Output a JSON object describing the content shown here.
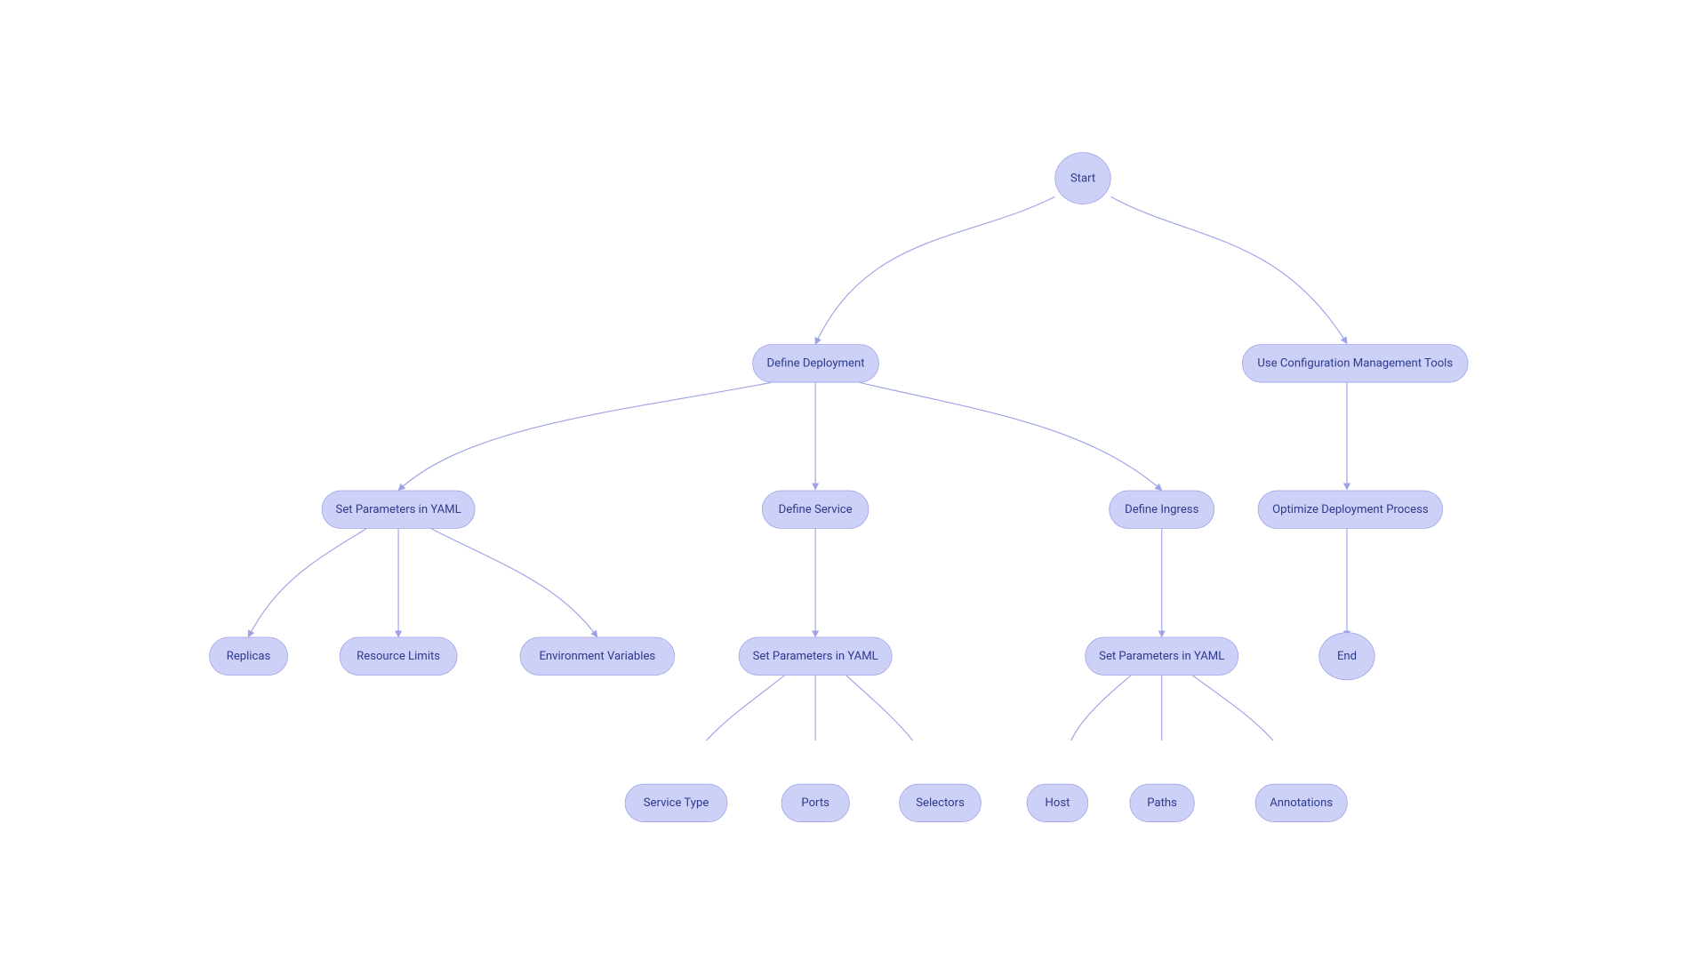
{
  "colors": {
    "nodeFill": "#cdd0f7",
    "nodeStroke": "#9ea3e6",
    "text": "#2e3a8c"
  },
  "nodes": {
    "start": {
      "label": "Start"
    },
    "defdep": {
      "label": "Define Deployment"
    },
    "usecfg": {
      "label": "Use Configuration Management Tools"
    },
    "setparams1": {
      "label": "Set Parameters in YAML"
    },
    "defsvc": {
      "label": "Define Service"
    },
    "defing": {
      "label": "Define Ingress"
    },
    "optdep": {
      "label": "Optimize Deployment Process"
    },
    "replicas": {
      "label": "Replicas"
    },
    "reslim": {
      "label": "Resource Limits"
    },
    "envvars": {
      "label": "Environment Variables"
    },
    "setparams2": {
      "label": "Set Parameters in YAML"
    },
    "setparams3": {
      "label": "Set Parameters in YAML"
    },
    "end": {
      "label": "End"
    },
    "svctype": {
      "label": "Service Type"
    },
    "ports": {
      "label": "Ports"
    },
    "selectors": {
      "label": "Selectors"
    },
    "host": {
      "label": "Host"
    },
    "paths": {
      "label": "Paths"
    },
    "annot": {
      "label": "Annotations"
    }
  }
}
